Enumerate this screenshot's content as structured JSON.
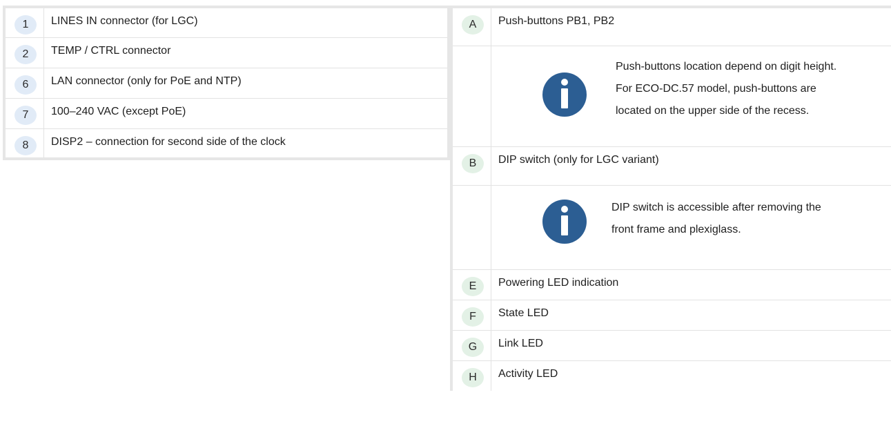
{
  "left_table": {
    "rows": [
      {
        "key": "1",
        "text": "LINES IN connector (for LGC)"
      },
      {
        "key": "2",
        "text": "TEMP / CTRL connector"
      },
      {
        "key": "6",
        "text": "LAN connector (only for PoE and NTP)"
      },
      {
        "key": "7",
        "text": "100–240 VAC (except PoE)"
      },
      {
        "key": "8",
        "text": "DISP2 – connection for second side of the clock"
      }
    ]
  },
  "right_table": {
    "row_a": {
      "key": "A",
      "text": "Push-buttons PB1, PB2"
    },
    "note_1": {
      "lines": [
        "Push-buttons location depend on digit height.",
        "For ECO-DC.57 model, push-buttons are",
        "located on the upper side of the recess."
      ]
    },
    "row_b": {
      "key": "B",
      "text": "DIP switch (only for LGC variant)"
    },
    "note_2": {
      "lines": [
        "DIP switch is accessible after removing the",
        "front frame and plexiglass."
      ]
    },
    "row_e": {
      "key": "E",
      "text": "Powering LED indication"
    },
    "row_f": {
      "key": "F",
      "text": "State LED"
    },
    "row_g": {
      "key": "G",
      "text": "Link LED"
    },
    "row_h": {
      "key": "H",
      "text": "Activity LED"
    }
  },
  "icons": {
    "info": "info-icon"
  },
  "colors": {
    "info_icon": "#2c5e93",
    "badge_blue": "#e1ebf7",
    "badge_green": "#e3f1e6",
    "border": "#e2e2e2"
  }
}
